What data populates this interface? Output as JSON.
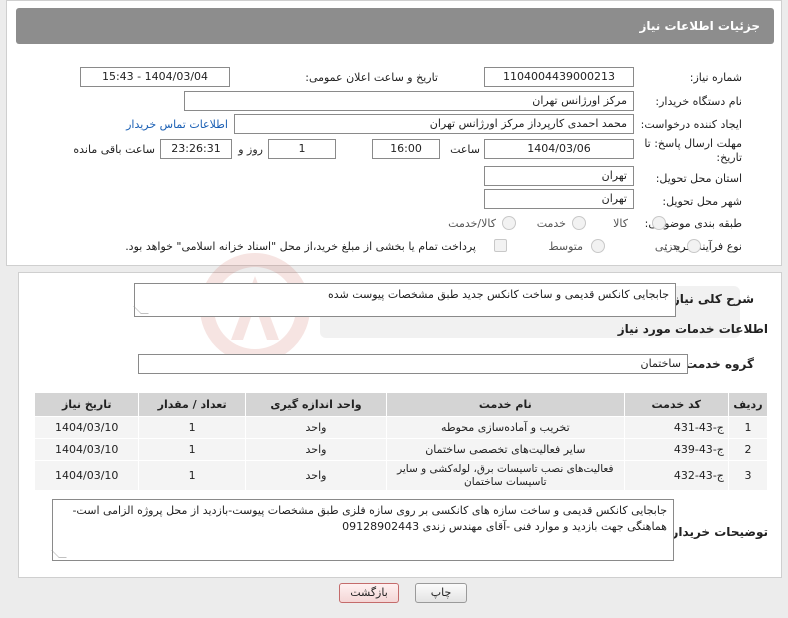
{
  "header": {
    "title": "جزئیات اطلاعات نیاز"
  },
  "form": {
    "need_number": {
      "label": "شماره نیاز:",
      "value": "1104004439000213"
    },
    "announce_datetime": {
      "label": "تاریخ و ساعت اعلان عمومی:",
      "value": "1404/03/04 - 15:43"
    },
    "buyer_org": {
      "label": "نام دستگاه خریدار:",
      "value": "مرکز اورژانس تهران"
    },
    "requester": {
      "label": "ایجاد کننده درخواست:",
      "value": "محمد احمدی کارپرداز مرکز اورژانس تهران"
    },
    "buyer_contact_link": "اطلاعات تماس خریدار",
    "deadline": {
      "label_line1": "مهلت ارسال پاسخ: تا",
      "label_line2": "تاریخ:",
      "date": "1404/03/06",
      "time_label": "ساعت",
      "time": "16:00",
      "days": "1",
      "days_label": "روز و",
      "remaining": "23:26:31",
      "remaining_label": "ساعت باقی مانده"
    },
    "delivery_province": {
      "label": "استان محل تحویل:",
      "value": "تهران"
    },
    "delivery_city": {
      "label": "شهر محل تحویل:",
      "value": "تهران"
    },
    "category": {
      "label": "طبقه بندی موضوعی:",
      "options": [
        "کالا",
        "خدمت",
        "کالا/خدمت"
      ]
    },
    "purchase_type": {
      "label": "نوع فرآیند خرید :",
      "options": [
        "جزیی",
        "متوسط"
      ],
      "checkbox_text": "پرداخت تمام یا بخشی از مبلغ خرید،از محل \"اسناد خزانه اسلامی\" خواهد بود."
    }
  },
  "summary": {
    "label": "شرح کلی نیاز:",
    "value": "جابجایی کانکس قدیمی و ساخت کانکس جدید طبق مشخصات پیوست شده"
  },
  "services": {
    "section_title": "اطلاعات خدمات مورد نیاز",
    "group_label": "گروه خدمت:",
    "group_value": "ساختمان",
    "columns": [
      "ردیف",
      "کد خدمت",
      "نام خدمت",
      "واحد اندازه گیری",
      "تعداد / مقدار",
      "تاریخ نیاز"
    ],
    "rows": [
      {
        "idx": "1",
        "code": "ج-43-431",
        "name": "تخریب و آماده‌سازی محوطه",
        "unit": "واحد",
        "qty": "1",
        "date": "1404/03/10"
      },
      {
        "idx": "2",
        "code": "ج-43-439",
        "name": "سایر فعالیت‌های تخصصی ساختمان",
        "unit": "واحد",
        "qty": "1",
        "date": "1404/03/10"
      },
      {
        "idx": "3",
        "code": "ج-43-432",
        "name": "فعالیت‌های نصب تاسیسات برق، لوله‌کشی و سایر تاسیسات ساختمان",
        "unit": "واحد",
        "qty": "1",
        "date": "1404/03/10"
      }
    ]
  },
  "buyer_notes": {
    "label": "توضیحات خریدار:",
    "value": "جابجایی کانکس قدیمی و ساخت سازه های کانکسی بر روی سازه فلزی طبق مشخصات پیوست-بازدید از محل پروژه الزامی است-هماهنگی جهت بازدید و موارد فنی -آقای مهندس زندی 09128902443"
  },
  "buttons": {
    "print": "چاپ",
    "back": "بازگشت"
  },
  "colors": {
    "header_bg": "#8d8d8d",
    "link": "#1a5fb4",
    "table_header": "#d4d4d4"
  }
}
